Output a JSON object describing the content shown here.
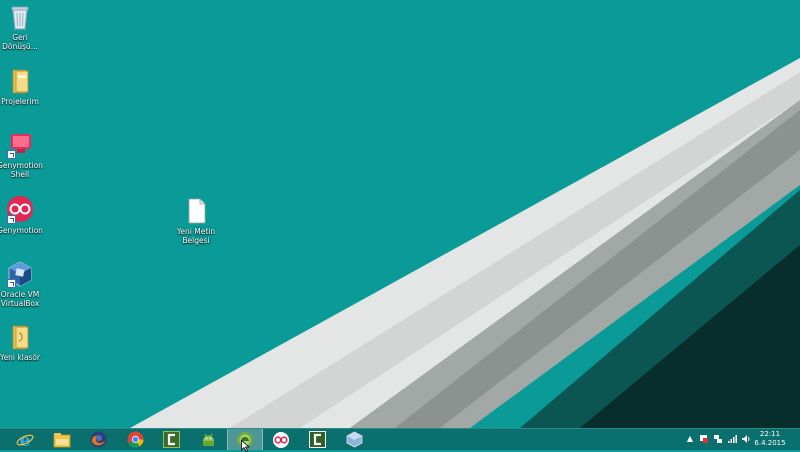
{
  "desktop": {
    "icons": [
      {
        "name": "recycle-bin",
        "label": "Geri\nDönüşü..."
      },
      {
        "name": "projelerim",
        "label": "Projelerim"
      },
      {
        "name": "genymotion-shell",
        "label": "Genymotion\nShell"
      },
      {
        "name": "genymotion",
        "label": "Genymotion"
      },
      {
        "name": "oracle-vm-virtualbox",
        "label": "Oracle VM\nVirtualBox"
      },
      {
        "name": "yeni-klasor",
        "label": "Yeni klasör"
      },
      {
        "name": "yeni-metin-belgesi",
        "label": "Yeni Metin\nBelgesi"
      }
    ]
  },
  "taskbar": {
    "pinned": [
      "internet-explorer",
      "file-explorer",
      "firefox",
      "chrome",
      "camtasia",
      "android-studio",
      "android-studio-active",
      "genymotion",
      "camtasia-recorder",
      "virtualbox"
    ],
    "active_index": 6,
    "tray_icons": [
      "show-hidden-icons",
      "flag-icon",
      "network-icon",
      "signal-icon",
      "volume-icon"
    ],
    "clock": {
      "time": "22:11",
      "date": "6.4.2015"
    }
  },
  "colors": {
    "desktop_teal": "#0a9a97",
    "light_band": "#e4e6e5",
    "gray_band": "#9fa6a4",
    "dark_teal": "#0b5553",
    "taskbar": "#0b6f6d"
  }
}
